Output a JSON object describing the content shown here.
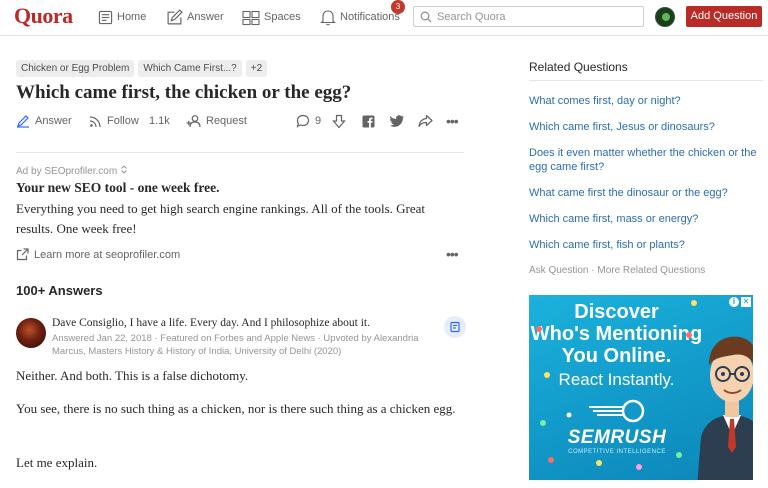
{
  "header": {
    "logo": "Quora",
    "nav": {
      "home": "Home",
      "answer": "Answer",
      "spaces": "Spaces",
      "notifications": "Notifications",
      "notification_count": "3"
    },
    "search_placeholder": "Search Quora",
    "add_question": "Add Question"
  },
  "question": {
    "tags": [
      "Chicken or Egg Problem",
      "Which Came First...?",
      "+2"
    ],
    "title": "Which came first, the chicken or the egg?",
    "actions": {
      "answer": "Answer",
      "follow": "Follow",
      "follow_count": "1.1k",
      "request": "Request",
      "comments": "9"
    }
  },
  "ad": {
    "label": "Ad by SEOprofiler.com",
    "title": "Your new SEO tool - one week free.",
    "body": "Everything you need to get high search engine rankings. All of the tools. Great results. One week free!",
    "link": "Learn more at seoprofiler.com"
  },
  "answers": {
    "count_label": "100+ Answers",
    "items": [
      {
        "author": "Dave Consiglio, I have a life. Every day. And I philosophize about it.",
        "meta": "Answered Jan 22, 2018 · Featured on Forbes and Apple News · Upvoted by Alexandria Marcus, Masters History & History of India, University of Delhi (2020)",
        "paragraphs": [
          "Neither. And both. This is a false dichotomy.",
          "You see, there is no such thing as a chicken, nor is there such thing as a chicken egg.",
          "Let me explain."
        ]
      }
    ]
  },
  "sidebar": {
    "title": "Related Questions",
    "related": [
      "What comes first, day or night?",
      "Which came first, Jesus or dinosaurs?",
      "Does it even matter whether the chicken or the egg came first?",
      "What came first the dinosaur or the egg?",
      "Which came first, mass or energy?",
      "Which came first, fish or plants?"
    ],
    "ask_question": "Ask Question",
    "more_related": "More Related Questions",
    "banner": {
      "line1": "Discover",
      "line2": "Who's Mentioning",
      "line3": "You Online.",
      "line4": "React Instantly.",
      "brand": "SEMRUSH",
      "brand_sub": "COMPETITIVE INTELLIGENCE"
    }
  },
  "colors": {
    "brand_red": "#b92b27",
    "link_blue": "#2b6dad",
    "banner_blue": "#1197c7"
  }
}
